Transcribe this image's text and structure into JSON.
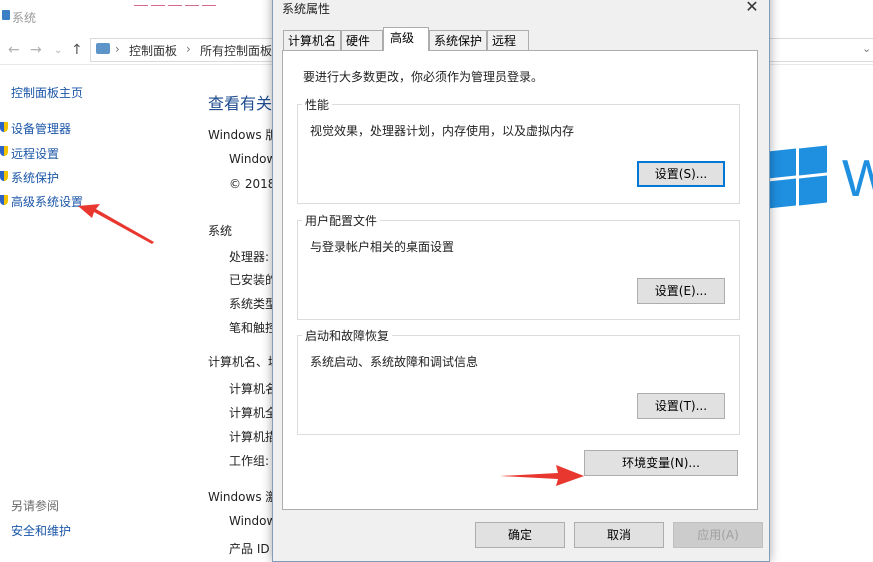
{
  "background_window": {
    "title": "系统",
    "address_bar": {
      "crumbs": [
        "控制面板",
        "所有控制面板"
      ],
      "separator": "›"
    },
    "left_pane": {
      "home_link": "控制面板主页",
      "links": [
        "设备管理器",
        "远程设置",
        "系统保护",
        "高级系统设置"
      ],
      "see_also_heading": "另请参阅",
      "see_also_links": [
        "安全和维护"
      ]
    },
    "main": {
      "heading": "查看有关",
      "windows_edition_label": "Windows 版",
      "windows_name": "Window",
      "copyright": "© 2018",
      "system_label": "系统",
      "system_rows": [
        "处理器:",
        "已安装的",
        "系统类型",
        "笔和触控"
      ],
      "computer_label": "计算机名、域",
      "computer_rows": [
        "计算机名",
        "计算机全",
        "计算机描",
        "工作组:"
      ],
      "activation_label": "Windows 激",
      "activation_row": "Window",
      "product_row": "产品 ID"
    },
    "logo_letter": "W"
  },
  "dialog": {
    "title": "系统属性",
    "close_glyph": "✕",
    "tabs": [
      "计算机名",
      "硬件",
      "高级",
      "系统保护",
      "远程"
    ],
    "active_tab": "高级",
    "admin_note": "要进行大多数更改，你必须作为管理员登录。",
    "groups": [
      {
        "label": "性能",
        "description": "视觉效果，处理器计划，内存使用，以及虚拟内存",
        "button": "设置(S)..."
      },
      {
        "label": "用户配置文件",
        "description": "与登录帐户相关的桌面设置",
        "button": "设置(E)..."
      },
      {
        "label": "启动和故障恢复",
        "description": "系统启动、系统故障和调试信息",
        "button": "设置(T)..."
      }
    ],
    "env_button": "环境变量(N)...",
    "footer_buttons": {
      "ok": "确定",
      "cancel": "取消",
      "apply": "应用(A)"
    }
  },
  "colors": {
    "link_blue": "#1a56a8",
    "heading_blue": "#1e4c8f",
    "windows_blue": "#1f8fe0",
    "annotation_red": "#e8372f",
    "focus_blue": "#0078d7"
  }
}
